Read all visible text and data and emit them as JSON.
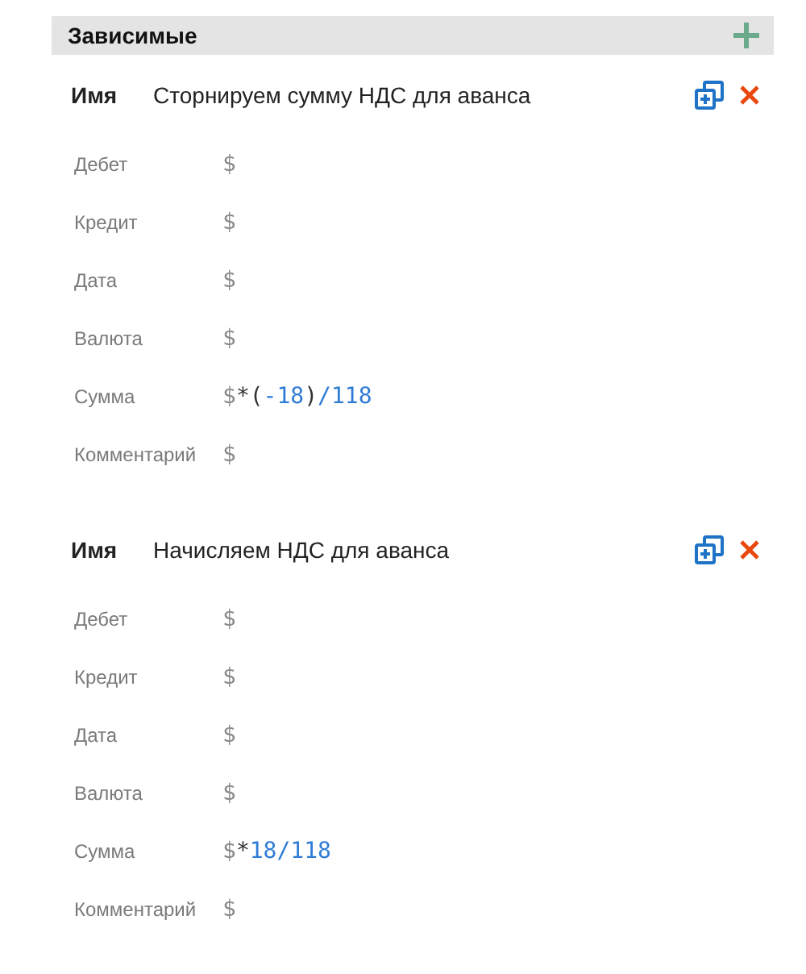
{
  "section": {
    "title": "Зависимые"
  },
  "entries": [
    {
      "name_label": "Имя",
      "name": "Сторнируем сумму НДС для аванса",
      "fields": [
        {
          "label": "Дебет",
          "tokens": [
            {
              "kind": "var",
              "text": "$"
            }
          ]
        },
        {
          "label": "Кредит",
          "tokens": [
            {
              "kind": "var",
              "text": "$"
            }
          ]
        },
        {
          "label": "Дата",
          "tokens": [
            {
              "kind": "var",
              "text": "$"
            }
          ]
        },
        {
          "label": "Валюта",
          "tokens": [
            {
              "kind": "var",
              "text": "$"
            }
          ]
        },
        {
          "label": "Сумма",
          "tokens": [
            {
              "kind": "var",
              "text": "$"
            },
            {
              "kind": "op",
              "text": "*("
            },
            {
              "kind": "num",
              "text": "-18"
            },
            {
              "kind": "op",
              "text": ")"
            },
            {
              "kind": "num",
              "text": "/118"
            }
          ]
        },
        {
          "label": "Комментарий",
          "tokens": [
            {
              "kind": "var",
              "text": "$"
            }
          ]
        }
      ]
    },
    {
      "name_label": "Имя",
      "name": "Начисляем НДС для аванса",
      "fields": [
        {
          "label": "Дебет",
          "tokens": [
            {
              "kind": "var",
              "text": "$"
            }
          ]
        },
        {
          "label": "Кредит",
          "tokens": [
            {
              "kind": "var",
              "text": "$"
            }
          ]
        },
        {
          "label": "Дата",
          "tokens": [
            {
              "kind": "var",
              "text": "$"
            }
          ]
        },
        {
          "label": "Валюта",
          "tokens": [
            {
              "kind": "var",
              "text": "$"
            }
          ]
        },
        {
          "label": "Сумма",
          "tokens": [
            {
              "kind": "var",
              "text": "$"
            },
            {
              "kind": "op",
              "text": "*"
            },
            {
              "kind": "num",
              "text": "18/118"
            }
          ]
        },
        {
          "label": "Комментарий",
          "tokens": [
            {
              "kind": "var",
              "text": "$"
            }
          ]
        }
      ]
    }
  ]
}
